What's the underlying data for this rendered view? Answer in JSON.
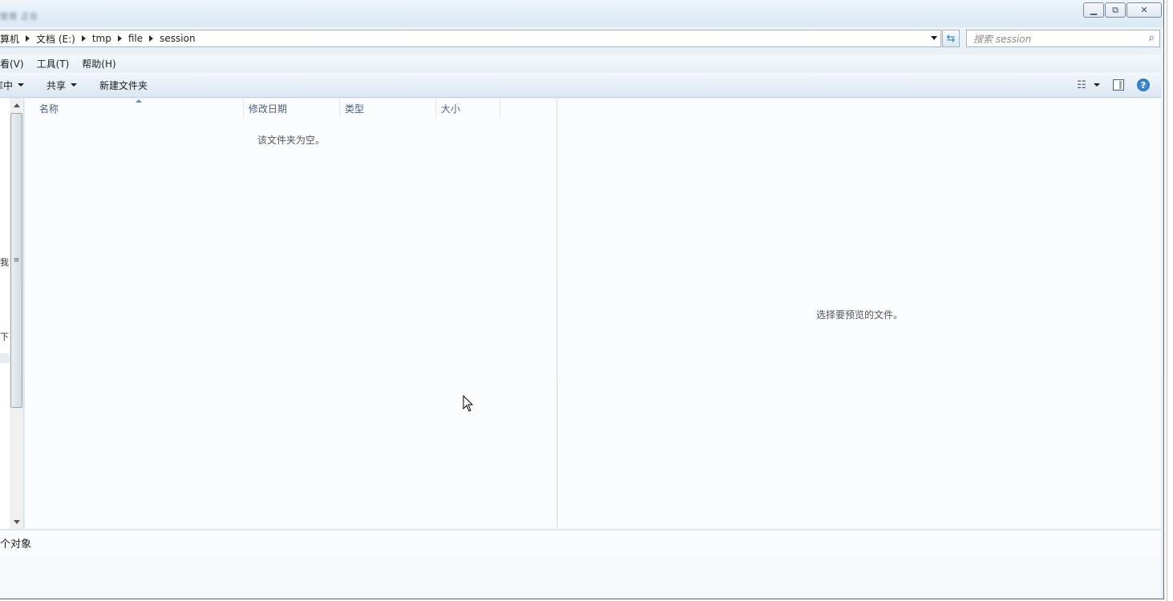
{
  "window": {
    "blurred_title": "管理 正在"
  },
  "address": {
    "crumbs": [
      "算机",
      "文档 (E:)",
      "tmp",
      "file",
      "session"
    ]
  },
  "search": {
    "placeholder": "搜索 session"
  },
  "menubar": {
    "items": [
      "查看(V)",
      "工具(T)",
      "帮助(H)"
    ],
    "first_clipped": "查看(V)"
  },
  "commandbar": {
    "include_clipped": "库中",
    "share": "共享",
    "new_folder": "新建文件夹"
  },
  "columns": {
    "name": "名称",
    "date": "修改日期",
    "type": "类型",
    "size": "大小"
  },
  "filelist": {
    "empty_message": "该文件夹为空。"
  },
  "preview": {
    "message": "选择要预览的文件。"
  },
  "navpane": {
    "clip1": "我",
    "clip2": "下"
  },
  "details": {
    "status": "个对象"
  },
  "colors": {
    "accent": "#2d7bc0",
    "frame": "#5d6a78"
  }
}
